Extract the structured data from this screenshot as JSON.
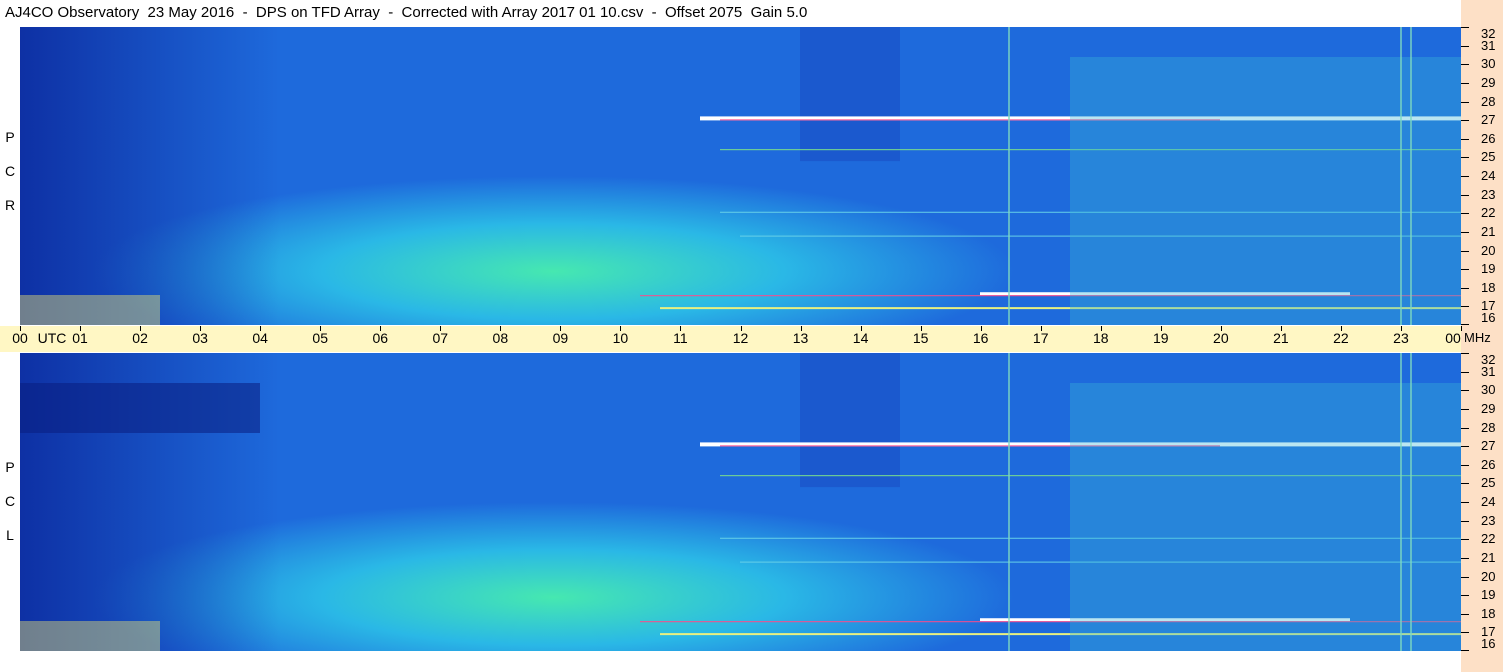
{
  "title": "AJ4CO Observatory  23 May 2016  -  DPS on TFD Array  -  Corrected with Array 2017 01 10.csv  -  Offset 2075  Gain 5.0",
  "panels": [
    {
      "label_letters": [
        "R",
        "C",
        "P"
      ]
    },
    {
      "label_letters": [
        "L",
        "C",
        "P"
      ]
    }
  ],
  "time_axis": {
    "utc_label": "UTC",
    "hours": [
      "00",
      "01",
      "02",
      "03",
      "04",
      "05",
      "06",
      "07",
      "08",
      "09",
      "10",
      "11",
      "12",
      "13",
      "14",
      "15",
      "16",
      "17",
      "18",
      "19",
      "20",
      "21",
      "22",
      "23",
      "00"
    ]
  },
  "freq_axis": {
    "unit": "MHz",
    "ticks": [
      "32",
      "31",
      "30",
      "29",
      "28",
      "27",
      "26",
      "25",
      "24",
      "23",
      "22",
      "21",
      "20",
      "19",
      "18",
      "17",
      "16"
    ]
  },
  "chart_data": {
    "type": "heatmap",
    "title": "AJ4CO Observatory  23 May 2016  -  DPS on TFD Array  -  Corrected with Array 2017 01 10.csv  -  Offset 2075  Gain 5.0",
    "x_unit": "UTC",
    "x_range": [
      "00",
      "00"
    ],
    "y_unit": "MHz",
    "y_range": [
      16,
      32
    ],
    "panels": [
      "RCP",
      "LCP"
    ],
    "colormap": [
      "#0a1a8a",
      "#1a5fd6",
      "#22a4f0",
      "#3ee0c0",
      "#b8f060",
      "#ff3030",
      "#ffffff"
    ]
  }
}
